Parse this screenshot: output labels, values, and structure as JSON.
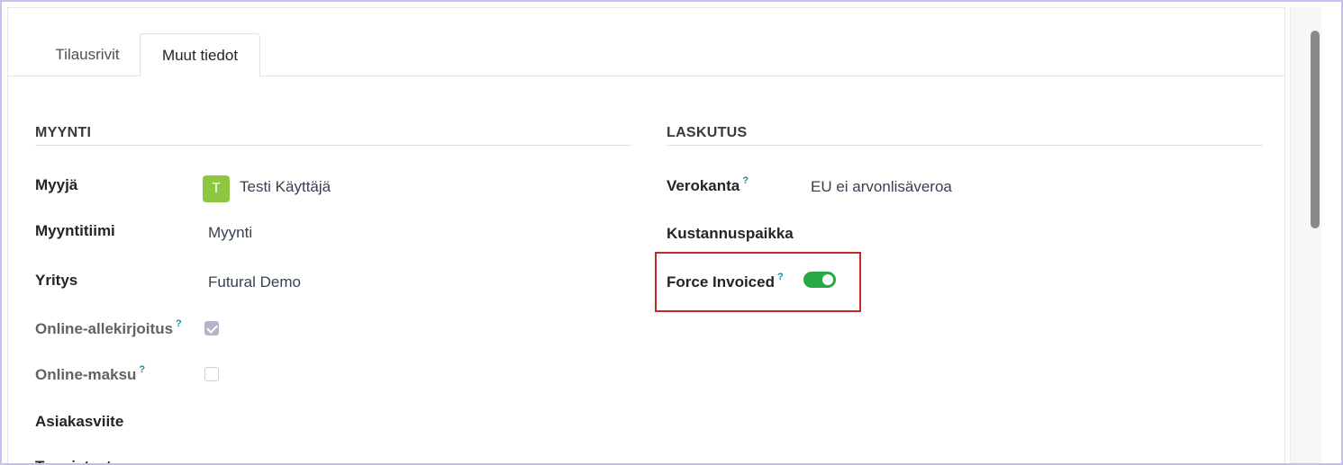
{
  "tabs": [
    {
      "label": "Tilausrivit",
      "active": false
    },
    {
      "label": "Muut tiedot",
      "active": true
    }
  ],
  "sales": {
    "title": "MYYNTI",
    "salesperson_label": "Myyjä",
    "salesperson_avatar": "T",
    "salesperson_value": "Testi Käyttäjä",
    "team_label": "Myyntitiimi",
    "team_value": "Myynti",
    "company_label": "Yritys",
    "company_value": "Futural Demo",
    "online_signature_label": "Online-allekirjoitus",
    "online_signature_checked": true,
    "online_payment_label": "Online-maksu",
    "online_payment_checked": false,
    "customer_ref_label": "Asiakasviite",
    "tags_label": "Tunnisteet"
  },
  "invoicing": {
    "title": "LASKUTUS",
    "fiscal_position_label": "Verokanta",
    "fiscal_position_value": "EU ei arvonlisäveroa",
    "analytic_account_label": "Kustannuspaikka",
    "force_invoiced_label": "Force Invoiced",
    "force_invoiced_on": true
  },
  "help_marker": "?",
  "colors": {
    "toggle_on": "#28a745",
    "avatar": "#8dc63f",
    "highlight": "#c62828",
    "frame": "#c7bff0"
  }
}
